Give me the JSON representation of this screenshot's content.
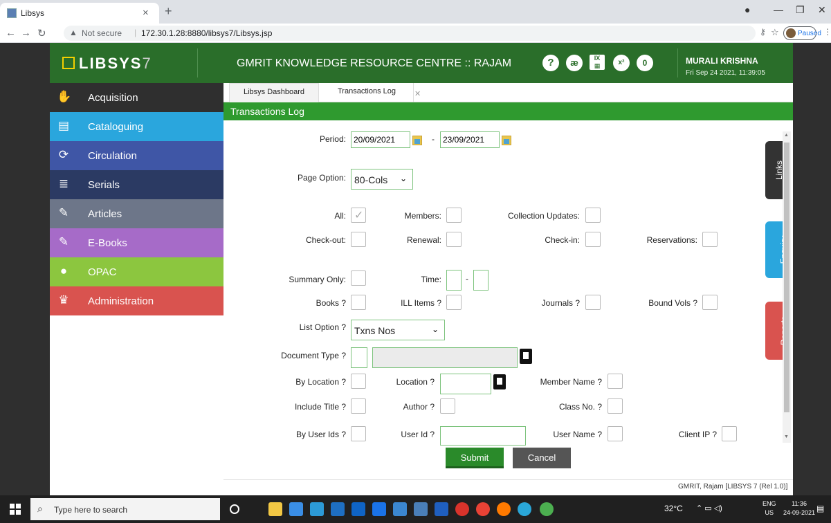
{
  "browser": {
    "tab_title": "Libsys",
    "tab_close": "×",
    "new_tab": "+",
    "not_secure": "Not secure",
    "url": "172.30.1.28:8880/libsys7/Libsys.jsp",
    "profile_status": "Paused"
  },
  "header": {
    "logo_text": "LIBSYS",
    "logo_version": "7",
    "org_title": "GMRIT KNOWLEDGE RESOURCE CENTRE :: RAJAM",
    "notification_count": "0",
    "user_name": "MURALI KRISHNA",
    "user_datetime": "Fri Sep 24 2021, 11:39:05"
  },
  "sidebar": {
    "items": [
      {
        "label": "Acquisition",
        "icon": "handshake-icon",
        "color": "#2f2f2f"
      },
      {
        "label": "Cataloguing",
        "icon": "book-icon",
        "color": "#2aa6dd"
      },
      {
        "label": "Circulation",
        "icon": "refresh-icon",
        "color": "#3f56a6"
      },
      {
        "label": "Serials",
        "icon": "stack-icon",
        "color": "#2b3a63"
      },
      {
        "label": "Articles",
        "icon": "edit-icon",
        "color": "#6d7689"
      },
      {
        "label": "E-Books",
        "icon": "edit-icon",
        "color": "#a66bc8"
      },
      {
        "label": "OPAC",
        "icon": "dots-icon",
        "color": "#8cc63f"
      },
      {
        "label": "Administration",
        "icon": "crown-icon",
        "color": "#d9534f"
      }
    ]
  },
  "tabs": {
    "dashboard": "Libsys Dashboard",
    "transactions": "Transactions Log",
    "close": "✕"
  },
  "section_title": "Transactions Log",
  "form": {
    "period_label": "Period:",
    "period_from": "20/09/2021",
    "period_sep": "-",
    "period_to": "23/09/2021",
    "page_option_label": "Page Option:",
    "page_option_value": "80-Cols",
    "all_label": "All:",
    "members_label": "Members:",
    "collection_updates_label": "Collection Updates:",
    "checkout_label": "Check-out:",
    "renewal_label": "Renewal:",
    "checkin_label": "Check-in:",
    "reservations_label": "Reservations:",
    "summary_only_label": "Summary Only:",
    "time_label": "Time:",
    "time_sep": "-",
    "books_label": "Books ?",
    "ill_items_label": "ILL Items ?",
    "journals_label": "Journals ?",
    "bound_vols_label": "Bound Vols ?",
    "list_option_label": "List Option ?",
    "list_option_value": "Txns Nos",
    "document_type_label": "Document Type ?",
    "by_location_label": "By Location ?",
    "location_label": "Location ?",
    "member_name_label": "Member Name ?",
    "include_title_label": "Include Title ?",
    "author_label": "Author ?",
    "class_no_label": "Class No. ?",
    "by_user_ids_label": "By User Ids ?",
    "user_id_label": "User Id ?",
    "user_name_label": "User Name ?",
    "client_ip_label": "Client IP ?",
    "submit": "Submit",
    "cancel": "Cancel"
  },
  "side_tabs": {
    "links": "Links",
    "enquiry": "Enquiry",
    "reports": "Reports"
  },
  "footer": "GMRIT, Rajam [LIBSYS 7 (Rel 1.0)]",
  "taskbar": {
    "search_placeholder": "Type here to search",
    "weather": "32°C",
    "lang_top": "ENG",
    "lang_bottom": "US",
    "time": "11:36",
    "date": "24-09-2021"
  }
}
